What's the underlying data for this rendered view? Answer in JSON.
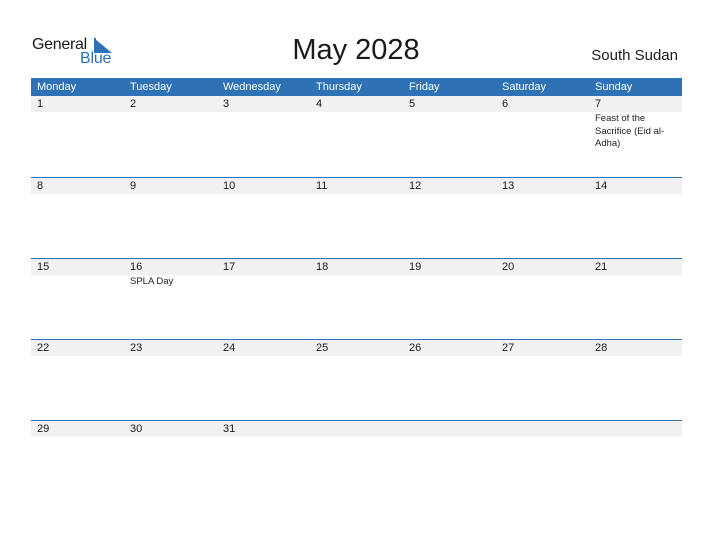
{
  "logo": {
    "word1": "General",
    "word2": "Blue"
  },
  "title": "May 2028",
  "country": "South Sudan",
  "colors": {
    "accent": "#2e72b5",
    "date_strip": "#f1f1f1"
  },
  "weekdays": [
    "Monday",
    "Tuesday",
    "Wednesday",
    "Thursday",
    "Friday",
    "Saturday",
    "Sunday"
  ],
  "weeks": [
    [
      {
        "day": "1",
        "holiday": ""
      },
      {
        "day": "2",
        "holiday": ""
      },
      {
        "day": "3",
        "holiday": ""
      },
      {
        "day": "4",
        "holiday": ""
      },
      {
        "day": "5",
        "holiday": ""
      },
      {
        "day": "6",
        "holiday": ""
      },
      {
        "day": "7",
        "holiday": "Feast of the Sacrifice (Eid al-Adha)"
      }
    ],
    [
      {
        "day": "8",
        "holiday": ""
      },
      {
        "day": "9",
        "holiday": ""
      },
      {
        "day": "10",
        "holiday": ""
      },
      {
        "day": "11",
        "holiday": ""
      },
      {
        "day": "12",
        "holiday": ""
      },
      {
        "day": "13",
        "holiday": ""
      },
      {
        "day": "14",
        "holiday": ""
      }
    ],
    [
      {
        "day": "15",
        "holiday": ""
      },
      {
        "day": "16",
        "holiday": "SPLA Day"
      },
      {
        "day": "17",
        "holiday": ""
      },
      {
        "day": "18",
        "holiday": ""
      },
      {
        "day": "19",
        "holiday": ""
      },
      {
        "day": "20",
        "holiday": ""
      },
      {
        "day": "21",
        "holiday": ""
      }
    ],
    [
      {
        "day": "22",
        "holiday": ""
      },
      {
        "day": "23",
        "holiday": ""
      },
      {
        "day": "24",
        "holiday": ""
      },
      {
        "day": "25",
        "holiday": ""
      },
      {
        "day": "26",
        "holiday": ""
      },
      {
        "day": "27",
        "holiday": ""
      },
      {
        "day": "28",
        "holiday": ""
      }
    ],
    [
      {
        "day": "29",
        "holiday": ""
      },
      {
        "day": "30",
        "holiday": ""
      },
      {
        "day": "31",
        "holiday": ""
      },
      {
        "day": "",
        "holiday": ""
      },
      {
        "day": "",
        "holiday": ""
      },
      {
        "day": "",
        "holiday": ""
      },
      {
        "day": "",
        "holiday": ""
      }
    ]
  ]
}
